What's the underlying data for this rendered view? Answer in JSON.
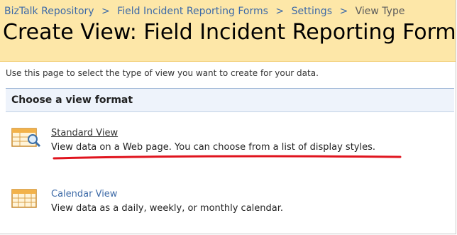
{
  "breadcrumb": {
    "items": [
      "BizTalk Repository",
      "Field Incident Reporting Forms",
      "Settings"
    ],
    "separator": ">",
    "current": "View Type"
  },
  "page": {
    "title": "Create View: Field Incident Reporting Forms",
    "intro": "Use this page to select the type of view you want to create for your data."
  },
  "section": {
    "title": "Choose a view format"
  },
  "views": [
    {
      "label": "Standard View",
      "description": "View data on a Web page. You can choose from a list of display styles.",
      "icon": "standard-view-icon"
    },
    {
      "label": "Calendar View",
      "description": "View data as a daily, weekly, or monthly calendar.",
      "icon": "calendar-view-icon"
    }
  ],
  "colors": {
    "header_bg": "#fde7a8",
    "link": "#3d6aa7",
    "annotation": "#e0141e"
  }
}
